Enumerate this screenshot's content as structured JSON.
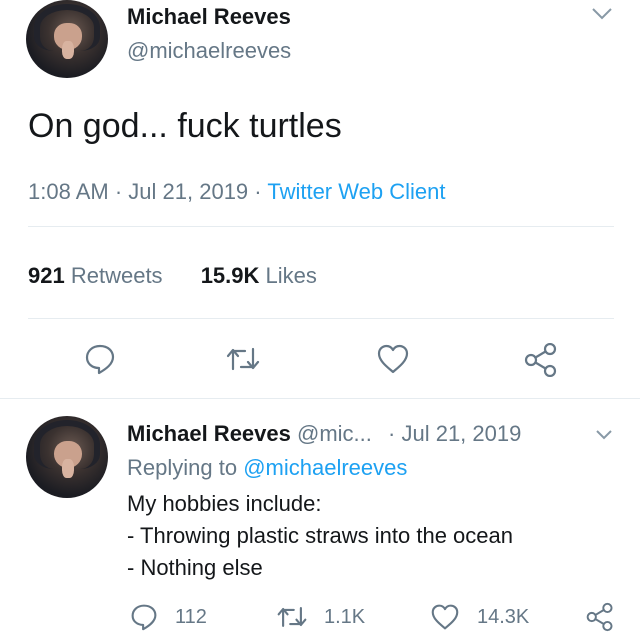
{
  "tweet": {
    "author_name": "Michael Reeves",
    "author_handle": "@michaelreeves",
    "text": "On god... fuck turtles",
    "time": "1:08 AM",
    "sep1": "·",
    "date": "Jul 21, 2019",
    "sep2": "·",
    "client": "Twitter Web Client",
    "retweets_count": "921",
    "retweets_label": "Retweets",
    "likes_count": "15.9K",
    "likes_label": "Likes"
  },
  "reply": {
    "author_name": "Michael Reeves",
    "author_handle": "@mic...",
    "sep": "·",
    "date": "Jul 21, 2019",
    "replying_prefix": "Replying to",
    "replying_handle": "@michaelreeves",
    "lines": [
      "My hobbies include:",
      "- Throwing plastic straws into the ocean",
      "- Nothing else"
    ],
    "reply_count": "112",
    "retweet_count": "1.1K",
    "like_count": "14.3K"
  },
  "colors": {
    "text": "#14171a",
    "secondary": "#657786",
    "link": "#1da1f2",
    "divider": "#e6ecf0"
  }
}
